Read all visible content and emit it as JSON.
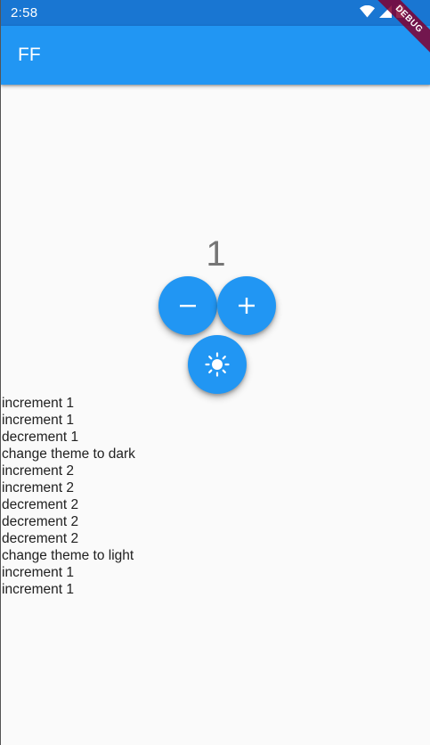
{
  "status_bar": {
    "time": "2:58"
  },
  "debug_banner": "DEBUG",
  "app_bar": {
    "title": "FF"
  },
  "counter": {
    "value": "1"
  },
  "buttons": {
    "decrement_icon": "minus-icon",
    "increment_icon": "plus-icon",
    "theme_icon": "sun-icon"
  },
  "colors": {
    "primary": "#2196f3",
    "status_bar": "#1976d2"
  },
  "log": [
    "increment 1",
    "increment 1",
    "decrement 1",
    "change theme to dark",
    "increment 2",
    "increment 2",
    "decrement 2",
    "decrement 2",
    "decrement 2",
    "change theme to light",
    "increment 1",
    "increment 1"
  ]
}
